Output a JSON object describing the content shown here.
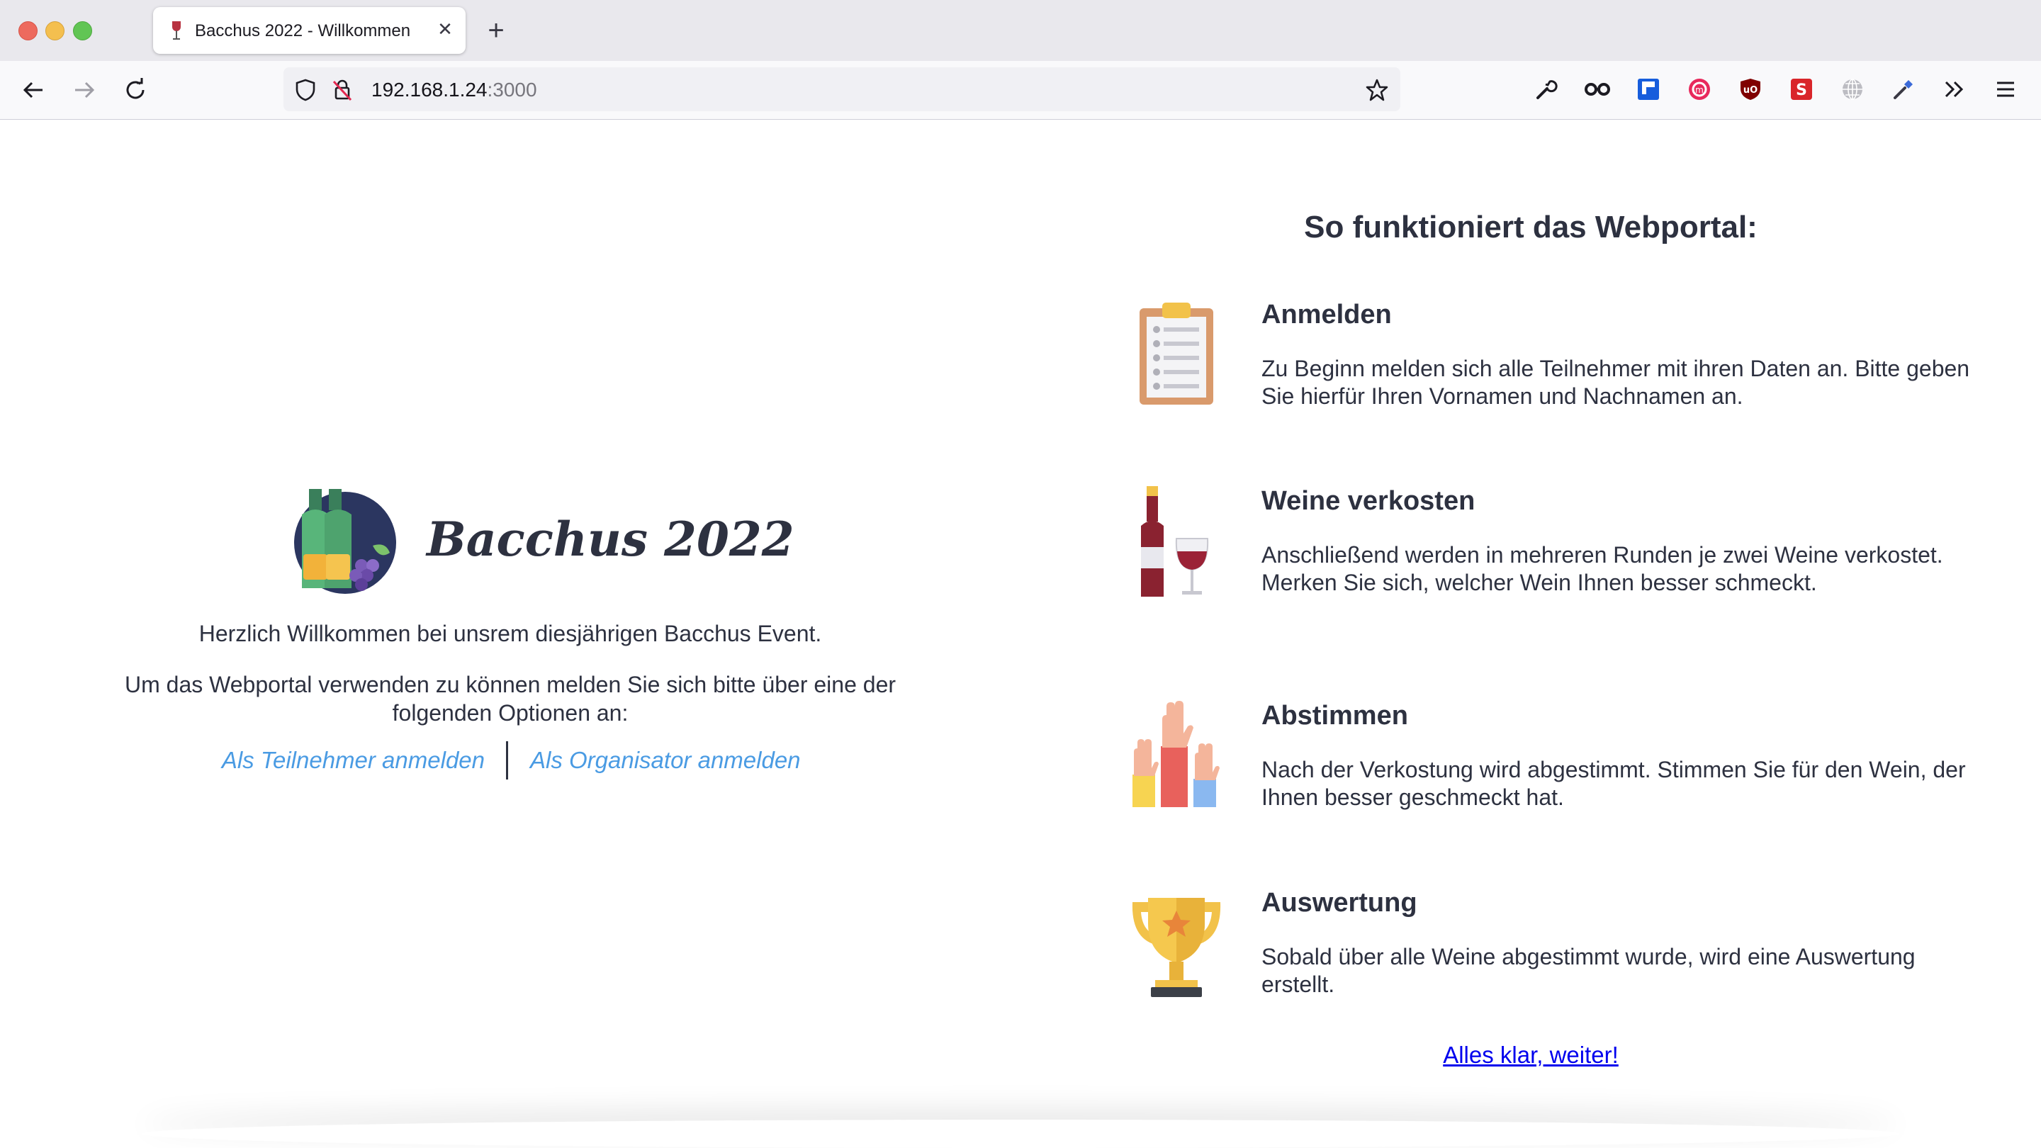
{
  "browser": {
    "tab_title": "Bacchus 2022 - Willkommen",
    "url_host": "192.168.1.24",
    "url_port": ":3000",
    "extension_icons": [
      "wrench-icon",
      "glasses-icon",
      "bitwarden-icon",
      "multi-account-icon",
      "ublock-icon",
      "shortkeys-icon",
      "globe-icon",
      "eyedropper-icon",
      "overflow-chevrons-icon",
      "hamburger-menu-icon"
    ]
  },
  "hero": {
    "title": "Bacchus 2022",
    "welcome": "Herzlich Willkommen bei unsrem diesjährigen Bacchus Event.",
    "instruction": "Um das Webportal verwenden zu können melden Sie sich bitte über eine der folgenden Optionen an:",
    "participant_link": "Als Teilnehmer anmelden",
    "organizer_link": "Als Organisator anmelden"
  },
  "howto": {
    "title": "So funktioniert das Webportal:",
    "steps": [
      {
        "heading": "Anmelden",
        "text": "Zu Beginn melden sich alle Teilnehmer mit ihren Daten an. Bitte geben Sie hierfür Ihren Vornamen und Nachnamen an.",
        "icon": "clipboard-icon"
      },
      {
        "heading": "Weine verkosten",
        "text": "Anschließend werden in mehreren Runden je zwei Weine verkostet. Merken Sie sich, welcher Wein Ihnen besser schmeckt.",
        "icon": "wine-bottle-glass-icon"
      },
      {
        "heading": "Abstimmen",
        "text": "Nach der Verkostung wird abgestimmt. Stimmen Sie für den Wein, der Ihnen besser geschmeckt hat.",
        "icon": "raised-hands-icon"
      },
      {
        "heading": "Auswertung",
        "text": "Sobald über alle Weine abgestimmt wurde, wird eine Auswertung erstellt.",
        "icon": "trophy-icon"
      }
    ],
    "continue_link": "Alles klar, weiter!"
  },
  "colors": {
    "link": "#4a9be3",
    "text": "#2d3140",
    "continue": "#0000ee"
  }
}
